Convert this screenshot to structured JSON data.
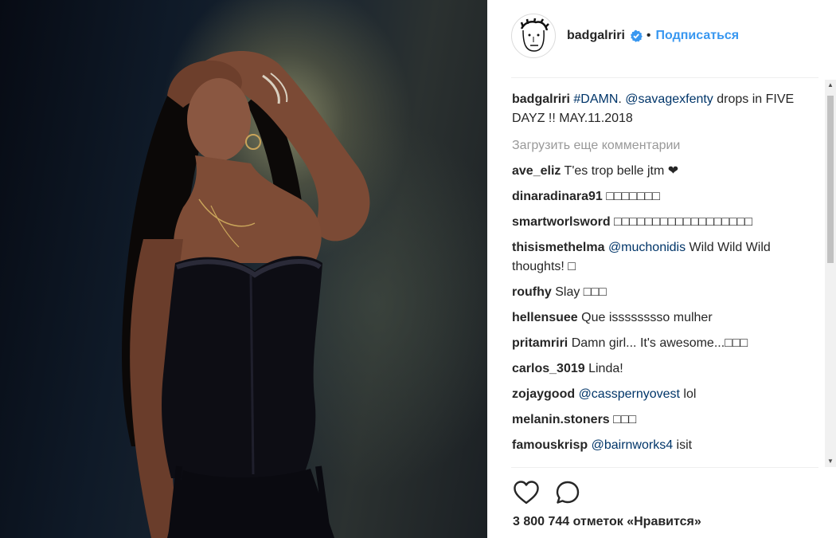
{
  "post": {
    "username": "badgalriri",
    "follow_label": "Подписаться",
    "separator": "•",
    "caption": {
      "username": "badgalriri",
      "hashtag": "#DAMN",
      "text_after_hashtag": ".",
      "mention": "@savagexfenty",
      "text": " drops in FIVE DAYZ !! MAY.11.2018"
    },
    "load_more_label": "Загрузить еще комментарии",
    "comments": [
      {
        "username": "ave_eliz",
        "mention": "",
        "text": "T'es trop belle jtm ❤"
      },
      {
        "username": "dinaradinara91",
        "mention": "",
        "text": "□□□□□□□"
      },
      {
        "username": "smartworlsword",
        "mention": "",
        "text": "□□□□□□□□□□□□□□□□□□"
      },
      {
        "username": "thisismethelma",
        "mention": "@muchonidis",
        "text": " Wild Wild Wild thoughts! □"
      },
      {
        "username": "roufhy",
        "mention": "",
        "text": "Slay □□□"
      },
      {
        "username": "hellensuee",
        "mention": "",
        "text": "Que isssssssso mulher"
      },
      {
        "username": "pritamriri",
        "mention": "",
        "text": "Damn girl... It's awesome...□□□"
      },
      {
        "username": "carlos_3019",
        "mention": "",
        "text": "Linda!"
      },
      {
        "username": "zojaygood",
        "mention": "@casspernyovest",
        "text": " lol"
      },
      {
        "username": "melanin.stoners",
        "mention": "",
        "text": "□□□"
      },
      {
        "username": "famouskrisp",
        "mention": "@bairnworks4",
        "text": " isit"
      }
    ],
    "likes_text": "3 800 744 отметок «Нравится»"
  },
  "icons": {
    "verified": "verified-badge-icon",
    "like": "heart-icon",
    "comment": "comment-bubble-icon",
    "scroll_up": "scroll-up-arrow",
    "scroll_down": "scroll-down-arrow"
  },
  "colors": {
    "link": "#003569",
    "follow": "#3897f0",
    "muted": "#999999",
    "verified": "#3897f0"
  }
}
